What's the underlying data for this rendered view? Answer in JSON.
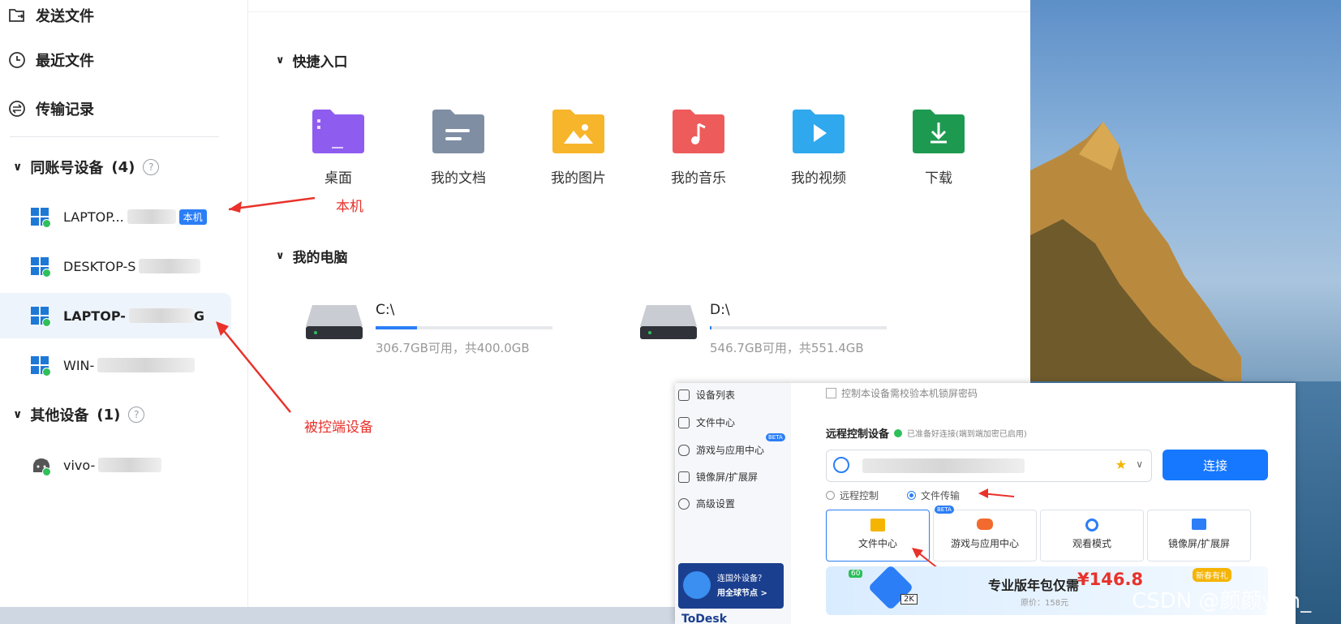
{
  "sidebar": {
    "nav": [
      "发送文件",
      "最近文件",
      "传输记录"
    ],
    "group_same": {
      "label": "同账号设备",
      "count": "(4)"
    },
    "devices": [
      {
        "name": "LAPTOP...",
        "badge": "本机"
      },
      {
        "name": "DESKTOP-S"
      },
      {
        "name": "LAPTOP-",
        "suffix": "G"
      },
      {
        "name": "WIN-"
      }
    ],
    "group_other": {
      "label": "其他设备",
      "count": "(1)"
    },
    "other_devices": [
      {
        "name": "vivo-"
      }
    ]
  },
  "annotations": {
    "local": "本机",
    "controlled": "被控端设备"
  },
  "main": {
    "quick_access": {
      "title": "快捷入口",
      "items": [
        {
          "label": "桌面",
          "color": "#8f5cf0",
          "icon": "desktop-folder-icon"
        },
        {
          "label": "我的文档",
          "color": "#7f8ea3",
          "icon": "documents-folder-icon"
        },
        {
          "label": "我的图片",
          "color": "#f7b52c",
          "icon": "pictures-folder-icon"
        },
        {
          "label": "我的音乐",
          "color": "#ee5b5b",
          "icon": "music-folder-icon"
        },
        {
          "label": "我的视频",
          "color": "#2fa8ee",
          "icon": "video-folder-icon"
        },
        {
          "label": "下载",
          "color": "#1d9a50",
          "icon": "download-folder-icon"
        }
      ]
    },
    "my_computer": {
      "title": "我的电脑",
      "drives": [
        {
          "name": "C:\\",
          "info": "306.7GB可用，共400.0GB",
          "used_fraction": 0.233
        },
        {
          "name": "D:\\",
          "info": "546.7GB可用，共551.4GB",
          "used_fraction": 0.0085
        }
      ]
    }
  },
  "panel": {
    "menu": [
      "设备列表",
      "文件中心",
      "游戏与应用中心",
      "镜像屏/扩展屏",
      "高级设置"
    ],
    "beta": "BETA",
    "top_note": "控制本设备需校验本机锁屏密码",
    "remote_title": "远程控制设备",
    "status": "已准备好连接(端到端加密已启用)",
    "connect": "连接",
    "modes": [
      "远程控制",
      "文件传输"
    ],
    "cards": [
      "文件中心",
      "游戏与应用中心",
      "观看模式",
      "镜像屏/扩展屏"
    ],
    "promo_side": [
      "连国外设备？",
      "用全球节点 >"
    ],
    "ad": {
      "text": "专业版年包仅需",
      "price": "¥146.8",
      "original": "原价：158元",
      "tag": "新春有礼",
      "badge1": "60",
      "badge2": "2K"
    },
    "brand": "ToDesk"
  },
  "watermark": "CSDN @颜颜yan_"
}
